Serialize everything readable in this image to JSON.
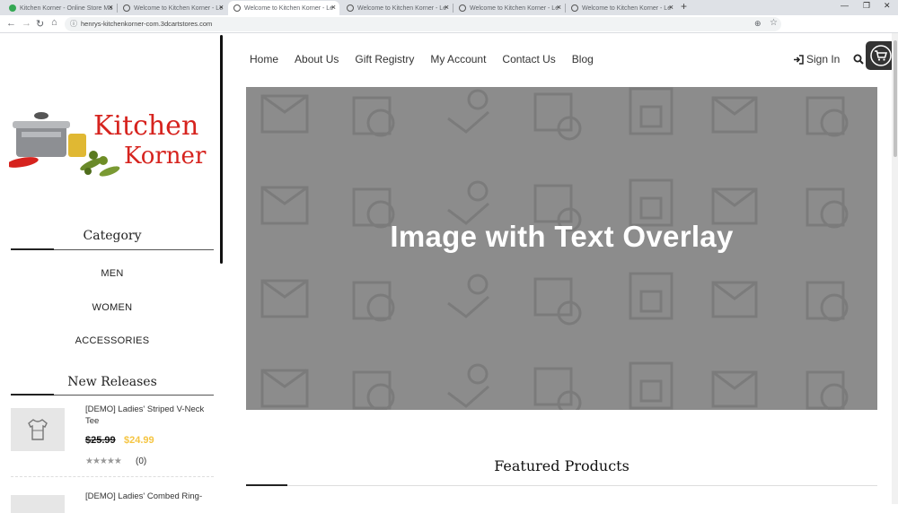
{
  "browser": {
    "tabs": [
      {
        "title": "Kitchen Korner - Online Store Ma",
        "active": false
      },
      {
        "title": "Welcome to Kitchen Korner - Le",
        "active": false
      },
      {
        "title": "Welcome to Kitchen Korner - Le",
        "active": true
      },
      {
        "title": "Welcome to Kitchen Korner - Le",
        "active": false
      },
      {
        "title": "Welcome to Kitchen Korner - Le",
        "active": false
      },
      {
        "title": "Welcome to Kitchen Korner - Le",
        "active": false
      }
    ],
    "url": "henrys-kitchenkorner-com.3dcartstores.com"
  },
  "logo": {
    "line1": "Kitchen",
    "line2": "Korner"
  },
  "nav": {
    "items": [
      "Home",
      "About Us",
      "Gift Registry",
      "My Account",
      "Contact Us",
      "Blog"
    ],
    "signin": "Sign In"
  },
  "sidebar": {
    "category_heading": "Category",
    "categories": [
      "MEN",
      "WOMEN",
      "ACCESSORIES"
    ],
    "new_releases_heading": "New Releases",
    "products": [
      {
        "name": "[DEMO] Ladies' Striped V-Neck Tee",
        "old_price": "$25.99",
        "new_price": "$24.99",
        "stars": "★★★★★",
        "reviews": "(0)"
      },
      {
        "name": "[DEMO] Ladies' Combed Ring-"
      }
    ]
  },
  "hero": {
    "text": "Image with Text Overlay"
  },
  "featured": {
    "title": "Featured Products"
  },
  "colors": {
    "accent_price": "#f5c542",
    "hero_bg": "#8c8c8c",
    "logo_red": "#d6231e"
  }
}
